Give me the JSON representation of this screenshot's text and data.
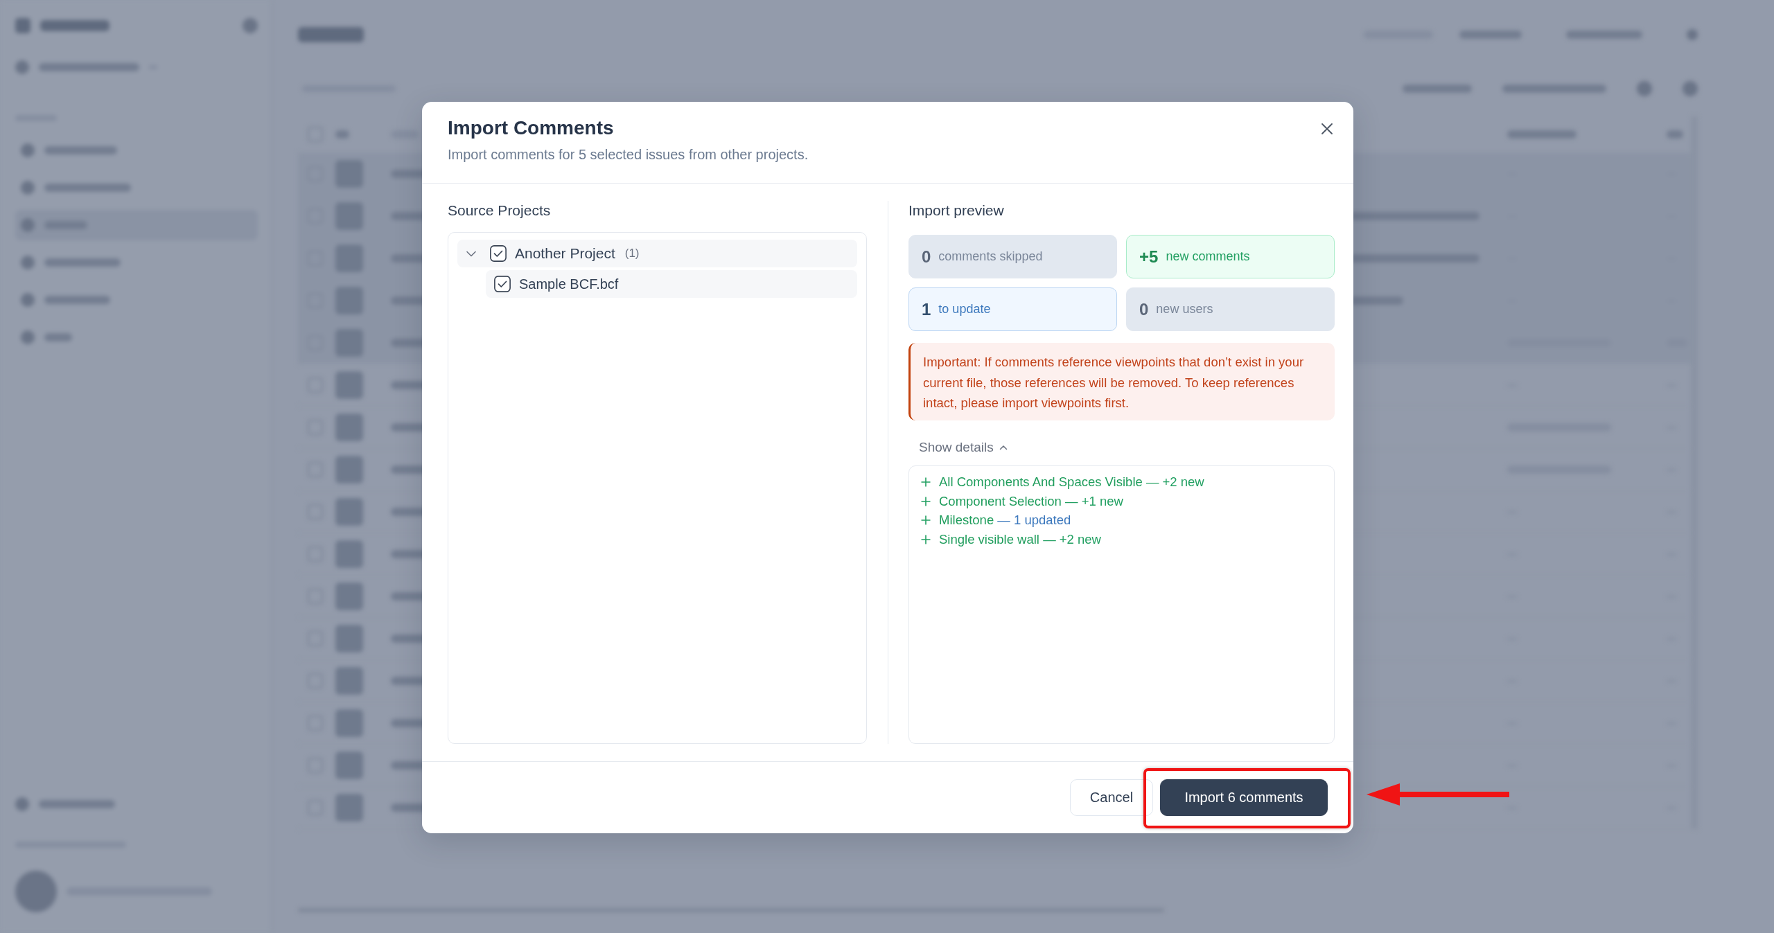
{
  "dialog": {
    "title": "Import Comments",
    "subtitle": "Import comments for 5 selected issues from other projects."
  },
  "source_projects": {
    "heading": "Source Projects",
    "tree": [
      {
        "label": "Another Project",
        "count": "(1)",
        "checked": true,
        "expanded": true,
        "children": [
          {
            "label": "Sample BCF.bcf",
            "checked": true
          }
        ]
      }
    ]
  },
  "import_preview": {
    "heading": "Import preview",
    "stats": [
      {
        "value": "0",
        "label": "comments skipped",
        "kind": "neutral"
      },
      {
        "value": "+5",
        "label": "new comments",
        "kind": "added"
      },
      {
        "value": "1",
        "label": "to update",
        "kind": "updated"
      },
      {
        "value": "0",
        "label": "new users",
        "kind": "neutral"
      }
    ],
    "warning": "Important: If comments reference viewpoints that don’t exist in your current file, those references will be removed. To keep references intact, please import viewpoints first.",
    "details_toggle": {
      "label": "Show details",
      "expanded": true
    },
    "details": [
      {
        "name": "All Components And Spaces Visible",
        "change": "— +2 new",
        "kind": "new"
      },
      {
        "name": "Component Selection",
        "change": "— +1 new",
        "kind": "new"
      },
      {
        "name": "Milestone",
        "change": "— 1 updated",
        "kind": "updated"
      },
      {
        "name": "Single visible wall",
        "change": "— +2 new",
        "kind": "new"
      }
    ]
  },
  "footer": {
    "buttons": [
      {
        "label": "Cancel",
        "kind": "secondary",
        "highlighted": false
      },
      {
        "label": "Import 6 comments",
        "kind": "primary",
        "highlighted": true
      }
    ]
  }
}
